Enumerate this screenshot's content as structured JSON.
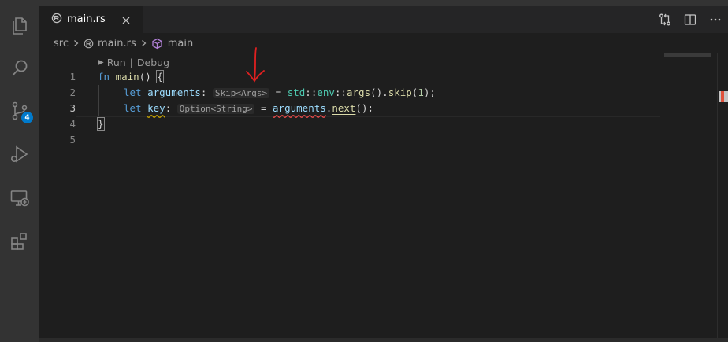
{
  "activity_bar": {
    "items": [
      {
        "name": "explorer-icon"
      },
      {
        "name": "search-icon"
      },
      {
        "name": "source-control-icon",
        "badge": "4"
      },
      {
        "name": "run-debug-icon"
      },
      {
        "name": "remote-explorer-icon"
      },
      {
        "name": "extensions-icon"
      }
    ]
  },
  "tabs": [
    {
      "label": "main.rs",
      "active": true
    }
  ],
  "breadcrumb": {
    "items": [
      "src",
      "main.rs",
      "main"
    ]
  },
  "codelens": {
    "run": "Run",
    "separator": "|",
    "debug": "Debug"
  },
  "editor": {
    "line_numbers": [
      "1",
      "2",
      "3",
      "4",
      "5"
    ],
    "line1": {
      "kw": "fn",
      "name": "main",
      "rest": "() ",
      "brace": "{"
    },
    "line2": {
      "kw": "let",
      "var": "arguments",
      "colon": ":",
      "hint": "Skip<Args>",
      "eq": " = ",
      "ns1": "std",
      "sep1": "::",
      "ns2": "env",
      "sep2": "::",
      "fn1": "args",
      "p1": "().",
      "fn2": "skip",
      "p2": "(",
      "num": "1",
      "p3": ");"
    },
    "line3": {
      "kw": "let",
      "var": "key",
      "colon": ":",
      "hint": "Option<String>",
      "eq": " = ",
      "var2": "arguments",
      "dot": ".",
      "fn": "next",
      "p": "();"
    },
    "line4": {
      "brace": "}"
    }
  },
  "colors": {
    "keyword": "#569cd6",
    "function": "#dcdcaa",
    "variable": "#9cdcfe",
    "namespace": "#4ec9b0",
    "number": "#b5cea8",
    "annotation_arrow": "#e02020"
  }
}
